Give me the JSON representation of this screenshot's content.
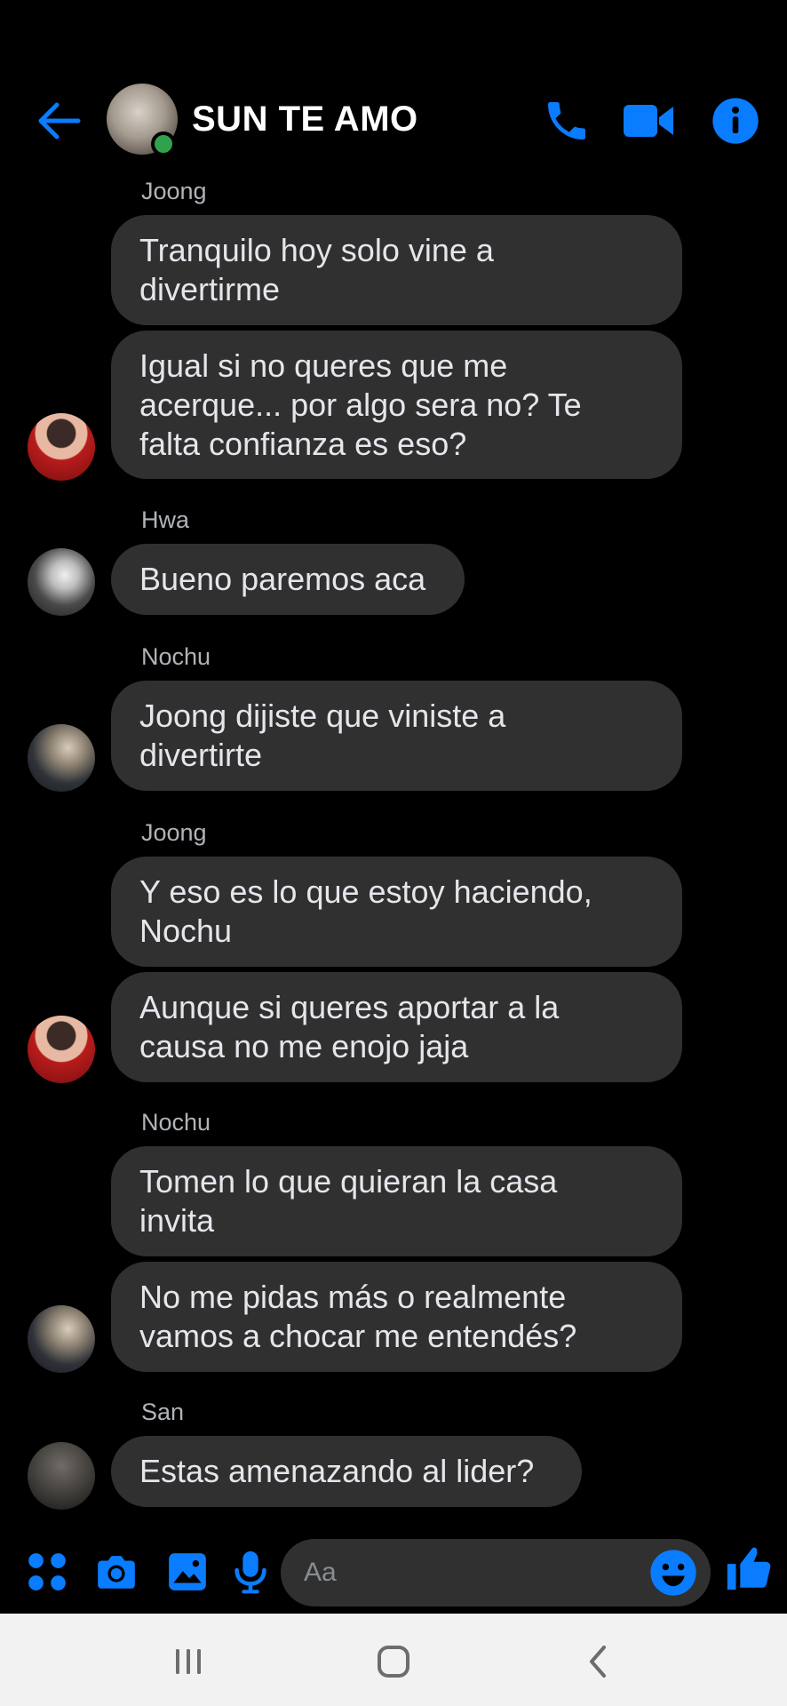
{
  "header": {
    "title": "SUN TE AMO",
    "icons": [
      "back-arrow-icon",
      "phone-icon",
      "video-camera-icon",
      "info-icon"
    ],
    "accent_color": "#0a7cff"
  },
  "messages": [
    {
      "sender": "Joong",
      "avatar": "joong",
      "bubbles": [
        {
          "lines": [
            "Tranquilo hoy solo vine a",
            "divertirme"
          ]
        },
        {
          "lines": [
            "Igual si no queres que me",
            "acerque... por algo sera no? Te",
            "falta confianza es eso?"
          ]
        }
      ]
    },
    {
      "sender": "Hwa",
      "avatar": "hwa",
      "bubbles": [
        {
          "lines": [
            "Bueno paremos aca"
          ]
        }
      ]
    },
    {
      "sender": "Nochu",
      "avatar": "nochu",
      "bubbles": [
        {
          "lines": [
            "Joong dijiste que viniste a",
            "divertirte"
          ]
        }
      ]
    },
    {
      "sender": "Joong",
      "avatar": "joong",
      "bubbles": [
        {
          "lines": [
            "Y eso es lo que estoy haciendo,",
            "Nochu"
          ]
        },
        {
          "lines": [
            "Aunque si queres aportar a la",
            "causa no me enojo jaja"
          ]
        }
      ]
    },
    {
      "sender": "Nochu",
      "avatar": "nochu",
      "bubbles": [
        {
          "lines": [
            "Tomen lo que quieran la casa",
            "invita"
          ]
        },
        {
          "lines": [
            "No me pidas más o realmente",
            "vamos a chocar me entendés?"
          ]
        }
      ]
    },
    {
      "sender": "San",
      "avatar": "san",
      "bubbles": [
        {
          "lines": [
            "Estas amenazando al lider?"
          ]
        }
      ]
    }
  ],
  "composer": {
    "placeholder": "Aa",
    "icons": [
      "apps-icon",
      "camera-icon",
      "gallery-icon",
      "microphone-icon",
      "emoji-icon",
      "thumbs-up-icon"
    ]
  },
  "navbar": {
    "icons": [
      "recent-apps-icon",
      "home-icon",
      "back-icon"
    ]
  }
}
